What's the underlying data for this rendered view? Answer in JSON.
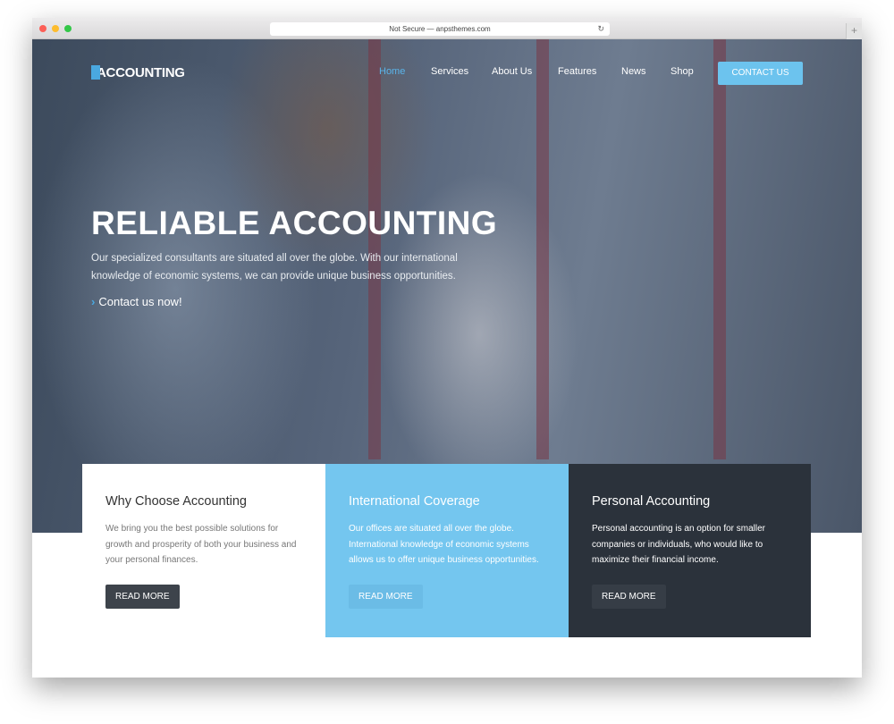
{
  "browser": {
    "url": "Not Secure — anpsthemes.com"
  },
  "nav": {
    "logo": "ACCOUNTING",
    "items": [
      "Home",
      "Services",
      "About Us",
      "Features",
      "News",
      "Shop"
    ],
    "active": "Home",
    "cta": "CONTACT US"
  },
  "hero": {
    "title": "RELIABLE ACCOUNTING",
    "text": "Our specialized consultants are situated all over the globe. With our international knowledge of economic systems, we can provide unique business opportunities.",
    "link": "Contact us now!"
  },
  "cards": [
    {
      "title": "Why Choose Accounting",
      "text": "We bring you the best possible solutions for growth and prosperity of both your business and your personal finances.",
      "button": "READ MORE"
    },
    {
      "title": "International Coverage",
      "text": "Our offices are situated all over the globe. International knowledge of economic systems allows us to offer unique business opportunities.",
      "button": "READ MORE"
    },
    {
      "title": "Personal Accounting",
      "text": "Personal accounting is an option for smaller companies or individuals, who would like to maximize their financial income.",
      "button": "READ MORE"
    }
  ],
  "colors": {
    "accent": "#6cc3ee",
    "dark": "#2b323b",
    "button_dark": "#3d434b"
  }
}
